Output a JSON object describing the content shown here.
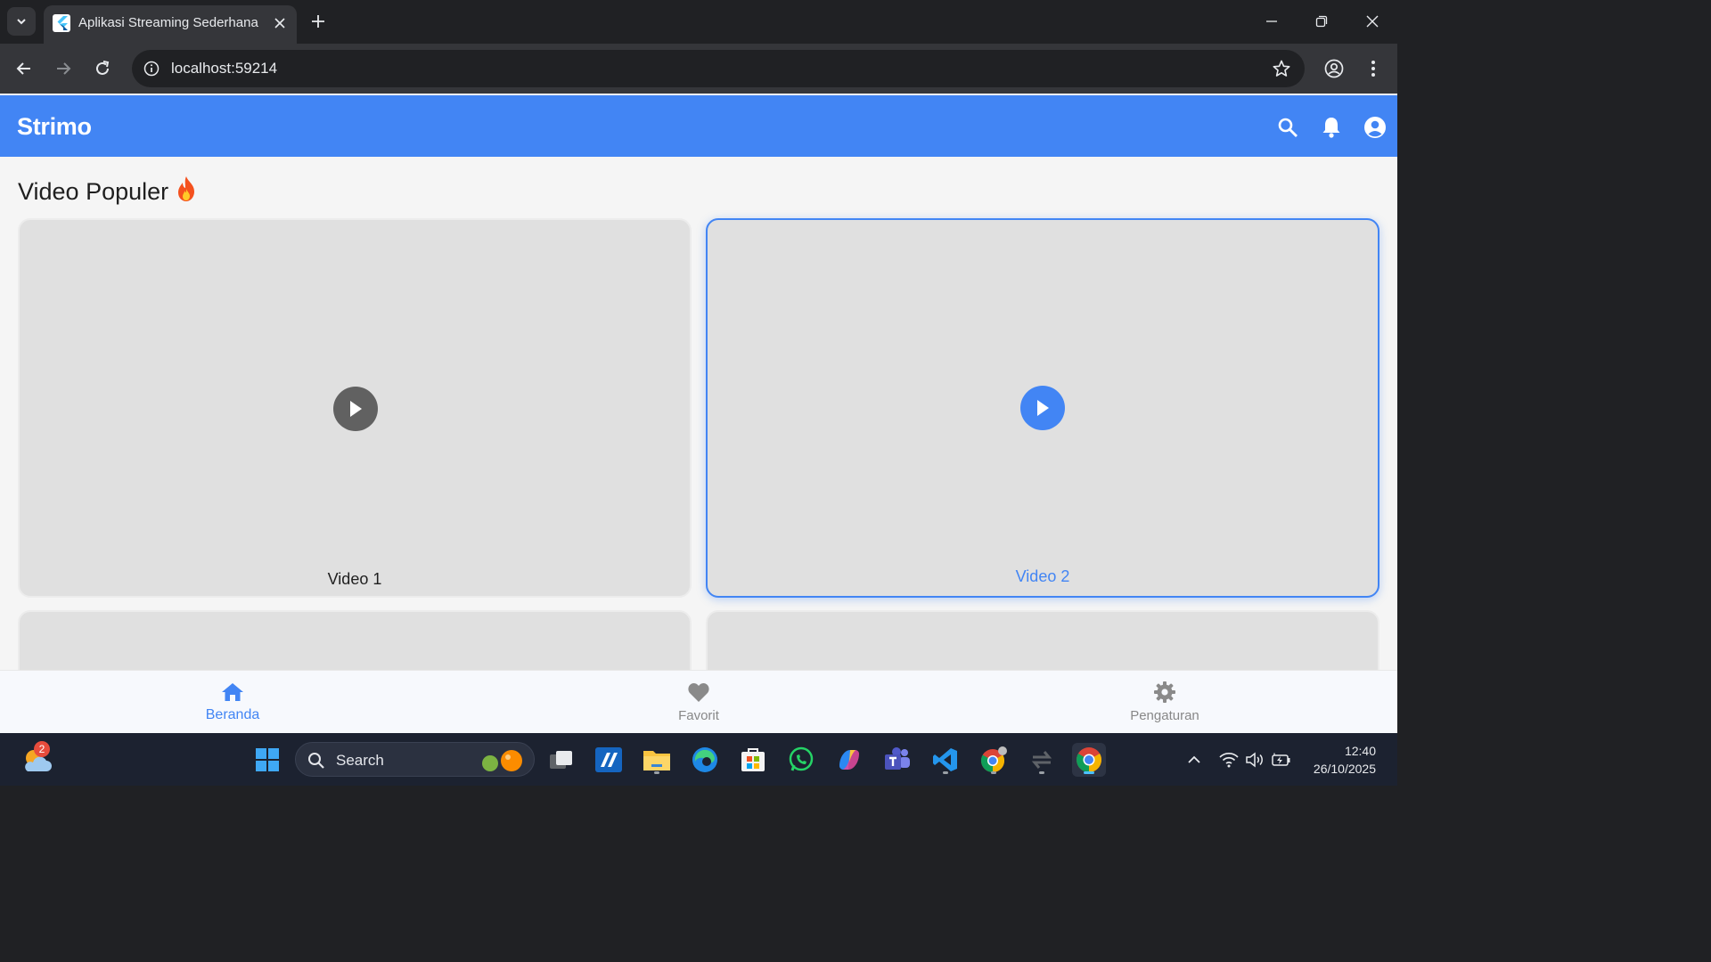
{
  "browser": {
    "tab_title": "Aplikasi Streaming Sederhana",
    "url": "localhost:59214"
  },
  "app": {
    "title": "Strimo",
    "accent_color": "#4285f4",
    "section_title": "Video Populer",
    "section_emoji": "fire-icon",
    "videos": [
      {
        "label": "Video 1",
        "selected": false
      },
      {
        "label": "Video 2",
        "selected": true
      }
    ],
    "bottom_nav": [
      {
        "label": "Beranda",
        "icon": "home-icon",
        "active": true
      },
      {
        "label": "Favorit",
        "icon": "heart-icon",
        "active": false
      },
      {
        "label": "Pengaturan",
        "icon": "gear-icon",
        "active": false
      }
    ]
  },
  "taskbar": {
    "search_placeholder": "Search",
    "weather_badge": "2",
    "time": "12:40",
    "date": "26/10/2025"
  }
}
